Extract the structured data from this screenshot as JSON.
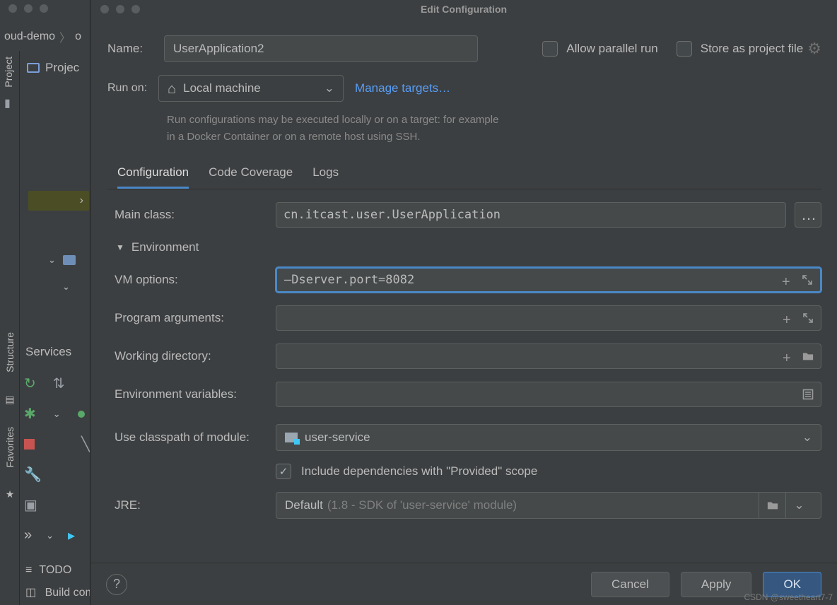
{
  "ide": {
    "breadcrumb_project": "oud-demo",
    "breadcrumb_next": "o",
    "project_label": "Projec",
    "sidebar_project": "Project",
    "services_label": "Services",
    "structure_label": "Structure",
    "favorites_label": "Favorites",
    "todo_label": "TODO",
    "build_label": "Build com"
  },
  "dialog": {
    "title": "Edit Configuration",
    "name_label": "Name:",
    "name_value": "UserApplication2",
    "allow_parallel": "Allow parallel run",
    "store_project": "Store as project file",
    "run_on_label": "Run on:",
    "run_on_value": "Local machine",
    "manage_targets": "Manage targets…",
    "hint_line1": "Run configurations may be executed locally or on a target: for example",
    "hint_line2": "in a Docker Container or on a remote host using SSH.",
    "tabs": {
      "configuration": "Configuration",
      "coverage": "Code Coverage",
      "logs": "Logs"
    },
    "main_class_label": "Main class:",
    "main_class_value": "cn.itcast.user.UserApplication",
    "environment_header": "Environment",
    "vm_options_label": "VM options:",
    "vm_options_value": "–Dserver.port=8082",
    "program_args_label": "Program arguments:",
    "program_args_value": "",
    "working_dir_label": "Working directory:",
    "working_dir_value": "",
    "env_vars_label": "Environment variables:",
    "env_vars_value": "",
    "classpath_label": "Use classpath of module:",
    "classpath_value": "user-service",
    "include_deps": "Include dependencies with \"Provided\" scope",
    "jre_label": "JRE:",
    "jre_value": "Default",
    "jre_hint": "(1.8 - SDK of 'user-service' module)",
    "cancel": "Cancel",
    "apply": "Apply",
    "ok": "OK"
  },
  "watermark": "CSDN @sweetheart7-7"
}
